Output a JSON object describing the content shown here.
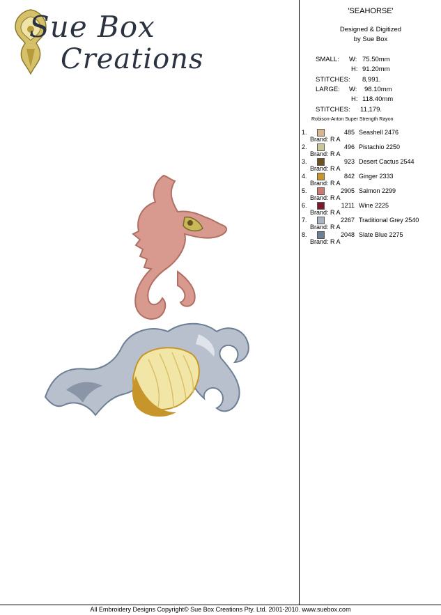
{
  "logo": {
    "line1": "Sue Box",
    "line2": "Creations"
  },
  "design": {
    "title": "'SEAHORSE'",
    "designed_line1": "Designed & Digitized",
    "designed_line2": "by Sue Box"
  },
  "specs": {
    "small_label": "SMALL:",
    "w_label": "W:",
    "h_label": "H:",
    "small_w": "75.50mm",
    "small_h": "91.20mm",
    "stitches_label": "STITCHES:",
    "small_stitches": "8,991.",
    "large_label": "LARGE:",
    "large_w": "98.10mm",
    "large_h": "118.40mm",
    "large_stitches": "11,179."
  },
  "thread_brand_note": "Robison-Anton Super Strength Rayon",
  "threads": [
    {
      "num": "1.",
      "code": "485",
      "name": "Seashell 2476",
      "brand": "Brand: R A",
      "color": "#d9b48f"
    },
    {
      "num": "2.",
      "code": "496",
      "name": "Pistachio 2250",
      "brand": "Brand: R A",
      "color": "#c9c79a"
    },
    {
      "num": "3.",
      "code": "923",
      "name": "Desert Cactus 2544",
      "brand": "Brand: R A",
      "color": "#6b5220"
    },
    {
      "num": "4.",
      "code": "842",
      "name": "Ginger 2333",
      "brand": "Brand: R A",
      "color": "#c6962c"
    },
    {
      "num": "5.",
      "code": "2905",
      "name": "Salmon 2299",
      "brand": "Brand: R A",
      "color": "#cc7b73"
    },
    {
      "num": "6.",
      "code": "1211",
      "name": "Wine 2225",
      "brand": "Brand: R A",
      "color": "#7a1a2b"
    },
    {
      "num": "7.",
      "code": "2267",
      "name": "Traditional Grey 2540",
      "brand": "Brand: R A",
      "color": "#a9b3c2"
    },
    {
      "num": "8.",
      "code": "2048",
      "name": "Slate Blue 2275",
      "brand": "Brand: R A",
      "color": "#6d7f95"
    }
  ],
  "footer": "All Embroidery Designs Copyright© Sue Box Creations Pty. Ltd. 2001-2010. www.suebox.com"
}
